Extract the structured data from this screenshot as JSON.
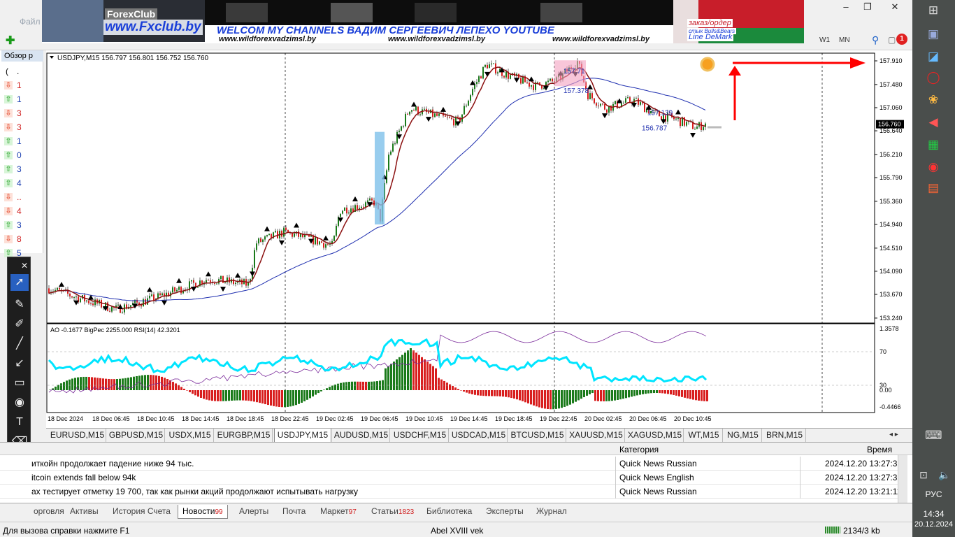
{
  "window": {
    "menu": [
      "Файл"
    ],
    "controls": [
      "–",
      "❐",
      "✕"
    ]
  },
  "banner": {
    "brand": "ForexClub",
    "site": "www.Fxclub.by",
    "welcome": "WELCOM MY CHANNELS ВАДИМ СЕРГЕЕВИЧ ЛЕПЕХО YOUTUBE",
    "urls": [
      "www.wildforexvadzimsl.by",
      "www.wildforexvadzimsl.by",
      "www.wildforexvadzimsl.by"
    ],
    "order": "заказ/ордер",
    "bulls": "стык Bulls&Bears",
    "demark": "Line DeMark"
  },
  "toolbar": {
    "timeframes": [
      "W1",
      "MN"
    ],
    "alert_count": "1"
  },
  "market_watch": {
    "title": "Обзор р",
    "header": [
      "(",
      "."
    ],
    "rows": [
      {
        "dir": "down",
        "val": "1"
      },
      {
        "dir": "up",
        "val": "1"
      },
      {
        "dir": "down",
        "val": "3"
      },
      {
        "dir": "down",
        "val": "3"
      },
      {
        "dir": "up",
        "val": "1"
      },
      {
        "dir": "up",
        "val": "0"
      },
      {
        "dir": "up",
        "val": "3"
      },
      {
        "dir": "up",
        "val": "4"
      },
      {
        "dir": "down",
        "val": ".."
      },
      {
        "dir": "down",
        "val": "4"
      },
      {
        "dir": "up",
        "val": "3"
      },
      {
        "dir": "down",
        "val": "8"
      },
      {
        "dir": "up",
        "val": "5"
      }
    ]
  },
  "chart": {
    "header": "USDJPY,M15  156.797 156.801 156.752 156.760",
    "current_price": "156.760",
    "price_axis": [
      "157.910",
      "157.480",
      "157.060",
      "156.640",
      "156.210",
      "155.790",
      "155.360",
      "154.940",
      "154.510",
      "154.090",
      "153.670",
      "153.240"
    ],
    "time_axis": [
      "18 Dec 2024",
      "18 Dec 06:45",
      "18 Dec 10:45",
      "18 Dec 14:45",
      "18 Dec 18:45",
      "18 Dec 22:45",
      "19 Dec 02:45",
      "19 Dec 06:45",
      "19 Dec 10:45",
      "19 Dec 14:45",
      "19 Dec 18:45",
      "19 Dec 22:45",
      "20 Dec 02:45",
      "20 Dec 06:45",
      "20 Dec 10:45"
    ],
    "annotations": [
      "157.378",
      "157.71",
      "156.787",
      "157.139"
    ],
    "indicator_header": "AO -0.1677  BigPec 2255.000  RSI(14) 42.3201",
    "indicator_axis": [
      "1.3578",
      "70",
      "30",
      "0.00",
      "-0.4466"
    ]
  },
  "symbol_tabs": [
    "EURUSD,M15",
    "GBPUSD,M15",
    "USDX,M15",
    "EURGBP,M15",
    "USDJPY,M15",
    "AUDUSD,M15",
    "USDCHF,M15",
    "USDCAD,M15",
    "BTCUSD,M15",
    "XAUUSD,M15",
    "XAGUSD,M15",
    "WT,M15",
    "NG,M15",
    "BRN,M15"
  ],
  "news": {
    "columns": {
      "category": "Категория",
      "time": "Время"
    },
    "rows": [
      {
        "title": "иткойн продолжает падение ниже 94 тыс.",
        "category": "Quick News Russian",
        "time": "2024.12.20 13:27:35"
      },
      {
        "title": "itcoin extends fall below 94k",
        "category": "Quick News English",
        "time": "2024.12.20 13:27:35"
      },
      {
        "title": "ах тестирует отметку 19 700, так как рынки акций продолжают испытывать нагрузку",
        "category": "Quick News Russian",
        "time": "2024.12.20 13:21:11"
      }
    ]
  },
  "terminal_tabs": [
    {
      "label": "орговля",
      "count": ""
    },
    {
      "label": "Активы",
      "count": ""
    },
    {
      "label": "История Счета",
      "count": ""
    },
    {
      "label": "Новости",
      "count": "99"
    },
    {
      "label": "Алерты",
      "count": ""
    },
    {
      "label": "Почта",
      "count": ""
    },
    {
      "label": "Маркет",
      "count": "97"
    },
    {
      "label": "Статьи",
      "count": "1823"
    },
    {
      "label": "Библиотека",
      "count": ""
    },
    {
      "label": "Эксперты",
      "count": ""
    },
    {
      "label": "Журнал",
      "count": ""
    }
  ],
  "status": {
    "help": "Для вызова справки нажмите F1",
    "profile": "Abel XVIII vek",
    "traffic": "2134/3 kb"
  },
  "taskbar": {
    "lang": "РУС",
    "time": "14:34",
    "date": "20.12.2024"
  },
  "colors": {
    "bull": "#1a7a1a",
    "bear": "#d81e1e",
    "ma_fast": "#8b1010",
    "ma_slow": "#2030b0",
    "rsi": "#00e5ff",
    "arrow": "#ff0000"
  }
}
